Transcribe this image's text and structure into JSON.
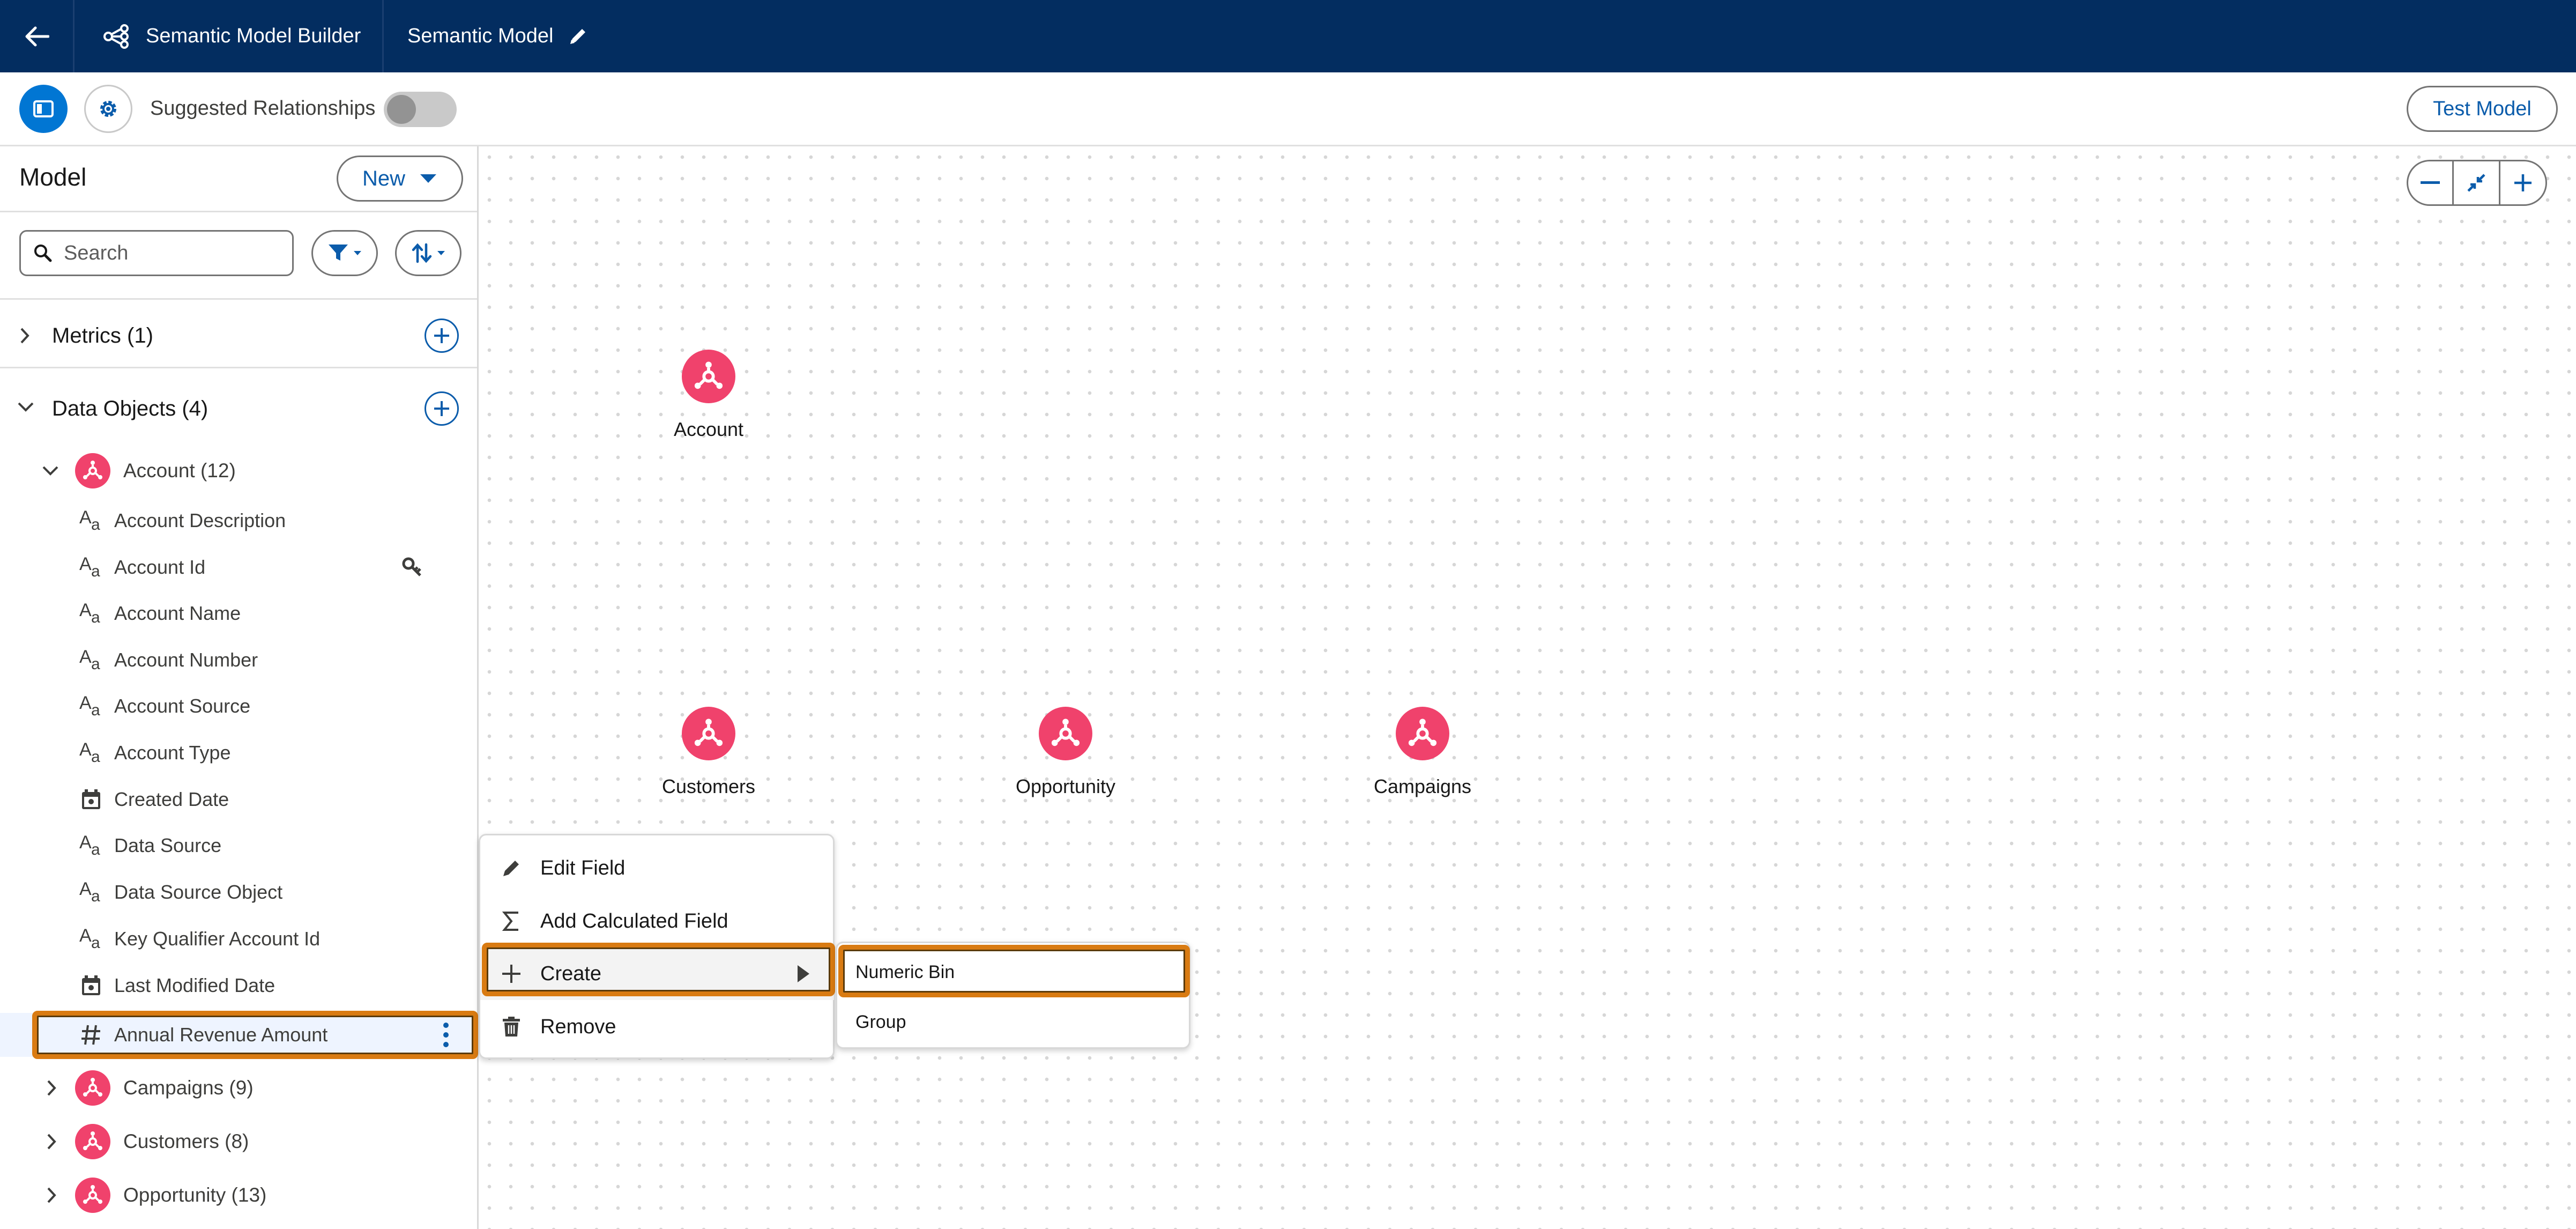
{
  "header": {
    "app_name": "Semantic Model Builder",
    "model_name": "Semantic Model"
  },
  "toolbar": {
    "suggested_label": "Suggested Relationships",
    "suggested_enabled": false,
    "test_model_label": "Test Model"
  },
  "left_panel": {
    "title": "Model",
    "new_label": "New",
    "search_placeholder": "Search",
    "metrics_label": "Metrics (1)",
    "data_objects_label": "Data Objects (4)",
    "account_label": "Account (12)",
    "account_fields": [
      "Account Description",
      "Account Id",
      "Account Name",
      "Account Number",
      "Account Source",
      "Account Type",
      "Created Date",
      "Data Source",
      "Data Source Object",
      "Key Qualifier Account Id",
      "Last Modified Date",
      "Annual Revenue Amount"
    ],
    "other_objects": [
      "Campaigns (9)",
      "Customers (8)",
      "Opportunity (13)"
    ]
  },
  "canvas": {
    "nodes": [
      "Account",
      "Customers",
      "Opportunity",
      "Campaigns"
    ]
  },
  "context_menu": {
    "items": [
      "Edit Field",
      "Add Calculated Field",
      "Create",
      "Remove"
    ]
  },
  "submenu": {
    "items": [
      "Numeric Bin",
      "Group"
    ]
  },
  "colors": {
    "header_bg": "#032d60",
    "brand_blue": "#0176d3",
    "object_pink": "#f0426c",
    "highlight_orange": "#d97b12"
  }
}
